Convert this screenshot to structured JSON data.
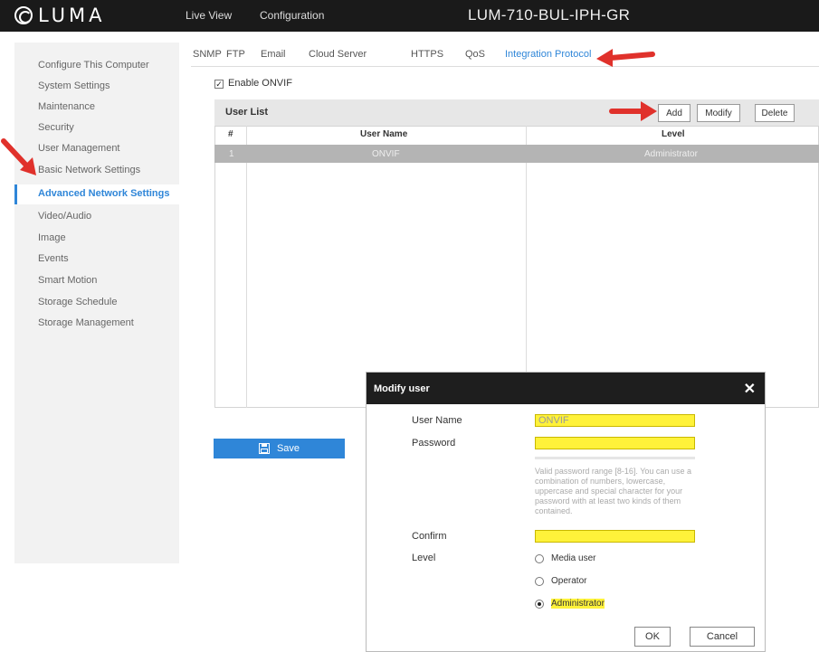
{
  "header": {
    "brand": "LUMA",
    "nav": [
      "Live View",
      "Configuration"
    ],
    "device_name": "LUM-710-BUL-IPH-GR"
  },
  "sidebar": {
    "items": [
      {
        "label": "Configure This Computer"
      },
      {
        "label": "System Settings"
      },
      {
        "label": "Maintenance"
      },
      {
        "label": "Security"
      },
      {
        "label": "User Management"
      },
      {
        "label": "Basic Network Settings"
      },
      {
        "label": "Advanced Network Settings",
        "active": true
      },
      {
        "label": "Video/Audio"
      },
      {
        "label": "Image"
      },
      {
        "label": "Events"
      },
      {
        "label": "Smart Motion"
      },
      {
        "label": "Storage Schedule"
      },
      {
        "label": "Storage Management"
      }
    ]
  },
  "tabs": [
    "SNMP",
    "FTP",
    "Email",
    "Cloud Server",
    "HTTPS",
    "QoS",
    "Integration Protocol"
  ],
  "active_tab": "Integration Protocol",
  "onvif": {
    "enable_label": "Enable ONVIF",
    "checked": true
  },
  "user_list": {
    "title": "User List",
    "buttons": {
      "add": "Add",
      "modify": "Modify",
      "delete": "Delete"
    },
    "columns": [
      "#",
      "User Name",
      "Level"
    ],
    "rows": [
      {
        "index": "1",
        "user_name": "ONVIF",
        "level": "Administrator"
      }
    ]
  },
  "save_label": "Save",
  "modal": {
    "title": "Modify user",
    "close": "✕",
    "user_name_label": "User Name",
    "user_name_value": "ONVIF",
    "password_label": "Password",
    "password_value": "",
    "hint": "Valid password range [8-16]. You can use a combination of numbers, lowercase, uppercase and special character for your password with at least two kinds of them contained.",
    "confirm_label": "Confirm",
    "confirm_value": "",
    "level_label": "Level",
    "levels": [
      "Media user",
      "Operator",
      "Administrator"
    ],
    "selected_level": "Administrator",
    "ok": "OK",
    "cancel": "Cancel"
  },
  "colors": {
    "accent": "#2f86d8",
    "highlight": "#fff23a",
    "arrow": "#e0312b",
    "topbar": "#1a1a1a"
  }
}
